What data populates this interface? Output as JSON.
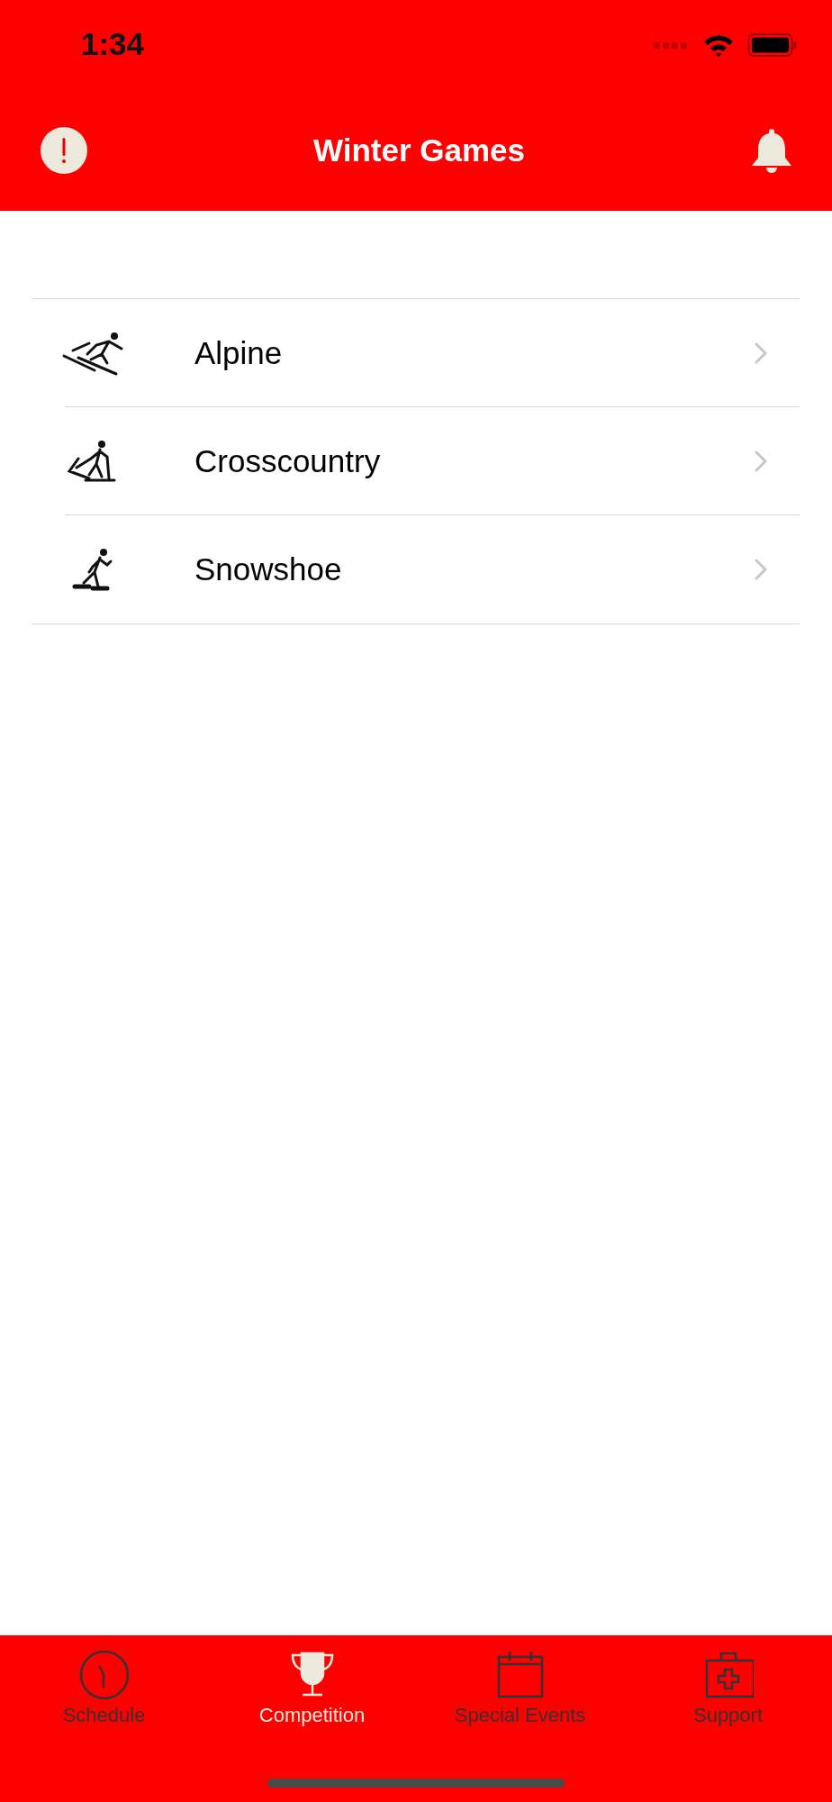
{
  "status_bar": {
    "time": "1:34"
  },
  "header": {
    "title": "Winter Games"
  },
  "list": [
    {
      "kind": "alpine",
      "label": "Alpine"
    },
    {
      "kind": "crosscountry",
      "label": "Crosscountry"
    },
    {
      "kind": "snowshoe",
      "label": "Snowshoe"
    }
  ],
  "tab_bar": [
    {
      "kind": "clock",
      "label": "Schedule",
      "selected": false
    },
    {
      "kind": "trophy",
      "label": "Competition",
      "selected": true
    },
    {
      "kind": "calendar",
      "label": "Special Events",
      "selected": false
    },
    {
      "kind": "medkit",
      "label": "Support",
      "selected": false
    }
  ]
}
